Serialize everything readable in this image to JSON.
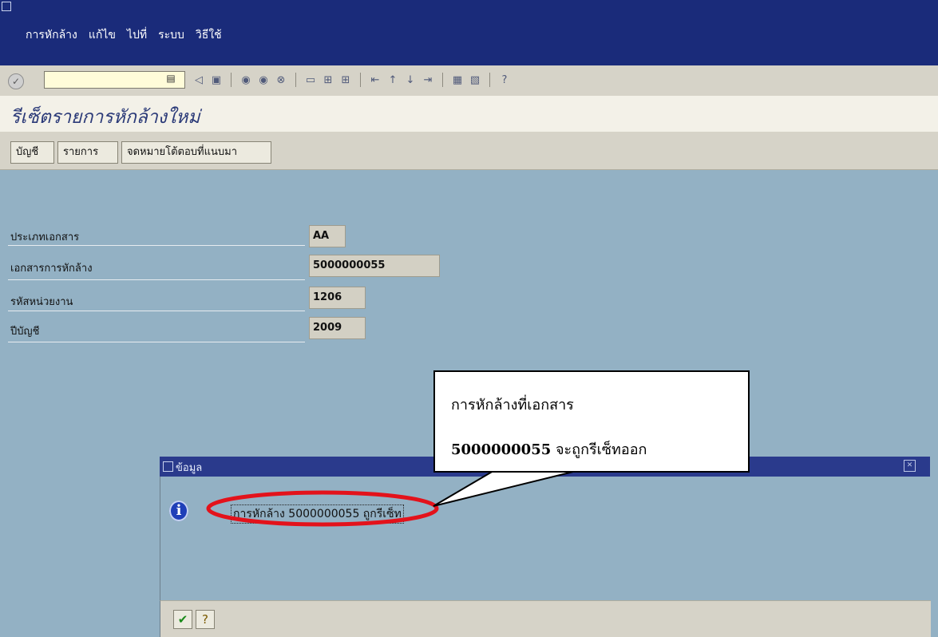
{
  "menubar": {
    "items": [
      "การหักล้าง",
      "แก้ไข",
      "ไปที่",
      "ระบบ",
      "วิธีใช้"
    ]
  },
  "toolbar": {
    "command_field_value": "",
    "icons": [
      "enter-icon",
      "back-icon",
      "save-icon",
      "green-back-icon",
      "exit-icon",
      "cancel-icon",
      "print-icon",
      "find-icon",
      "find-next-icon",
      "first-page-icon",
      "prev-page-icon",
      "next-page-icon",
      "last-page-icon",
      "create-session-icon",
      "shortcut-icon",
      "help-icon"
    ]
  },
  "page": {
    "title": "รีเซ็ตรายการหักล้างใหม่"
  },
  "app_toolbar": {
    "buttons": [
      "บัญชี",
      "รายการ",
      "จดหมายโต้ตอบที่แนบมา"
    ]
  },
  "form": {
    "fields": [
      {
        "label": "ประเภทเอกสาร",
        "value": "AA"
      },
      {
        "label": "เอกสารการหักล้าง",
        "value": "5000000055"
      },
      {
        "label": "รหัสหน่วยงาน",
        "value": "1206"
      },
      {
        "label": "ปีบัญชี",
        "value": "2009"
      }
    ]
  },
  "dialog": {
    "title": "ข้อมูล",
    "message": "การหักล้าง 5000000055 ถูกรีเซ็ท"
  },
  "callout": {
    "line1": "การหักล้างที่เอกสาร",
    "line2_number": "5000000055",
    "line2_text": " จะถูกรีเซ็ทออก"
  },
  "colors": {
    "menubar": "#1a2b7a",
    "background": "#93b1c4",
    "highlight_ellipse": "#e3121b"
  }
}
